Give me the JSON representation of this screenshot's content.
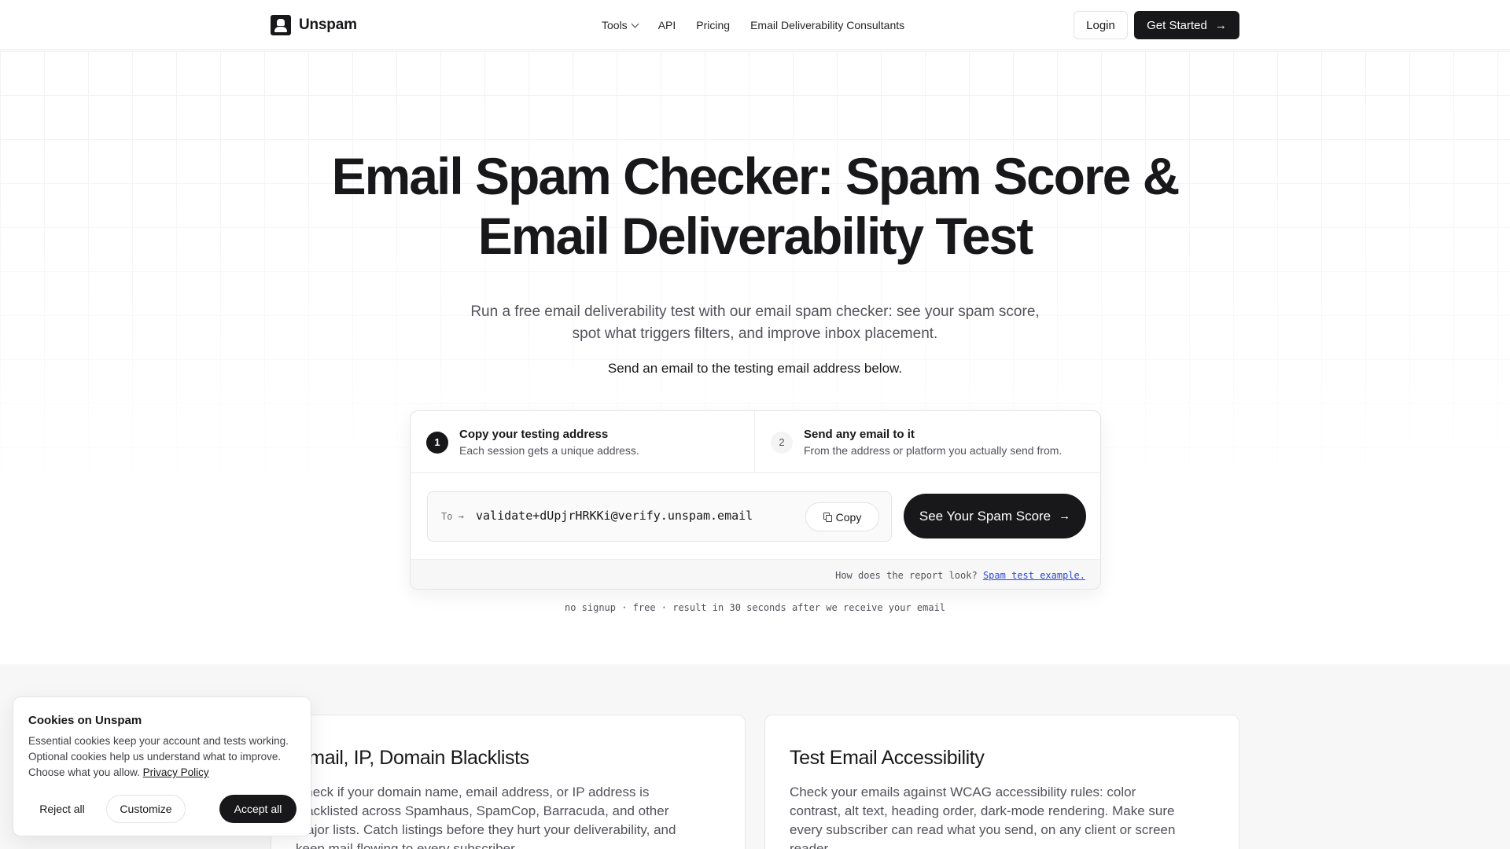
{
  "header": {
    "brand": "Unspam",
    "nav": [
      {
        "label": "Tools"
      },
      {
        "label": "API"
      },
      {
        "label": "Pricing"
      },
      {
        "label": "Email Deliverability Consultants"
      }
    ],
    "login_label": "Login",
    "get_started_label": "Get Started"
  },
  "hero": {
    "title_line1": "Email Spam Checker: Spam Score &",
    "title_line2": "Email Deliverability Test",
    "subtitle_line1": "Run a free email deliverability test with our email spam checker: see your spam score,",
    "subtitle_line2": "spot what triggers filters, and improve inbox placement.",
    "instruction": "Send an email to the testing email address below."
  },
  "tester": {
    "steps": [
      {
        "number": "1",
        "title": "Copy your testing address",
        "desc": "Each session gets a unique address."
      },
      {
        "number": "2",
        "title": "Send any email to it",
        "desc": "From the address or platform you actually send from."
      }
    ],
    "to_label": "To →",
    "address": "validate+dUpjrHRKKi@verify.unspam.email",
    "copy_label": "Copy",
    "cta_label": "See Your Spam Score",
    "footer_question": "How does the report look?",
    "footer_link": "Spam test example.",
    "tagline": "no signup · free · result in 30 seconds after we receive your email"
  },
  "features": [
    {
      "title": "Email, IP, Domain Blacklists",
      "desc": "Check if your domain name, email address, or IP address is blacklisted across Spamhaus, SpamCop, Barracuda, and other major lists. Catch listings before they hurt your deliverability, and keep mail flowing to every subscriber."
    },
    {
      "title": "Test Email Accessibility",
      "desc": "Check your emails against WCAG accessibility rules: color contrast, alt text, heading order, dark-mode rendering. Make sure every subscriber can read what you send, on any client or screen reader."
    }
  ],
  "cookie": {
    "title": "Cookies on Unspam",
    "text": "Essential cookies keep your account and tests working. Optional cookies help us understand what to improve. Choose what you allow.",
    "link": "Privacy Policy",
    "reject_label": "Reject all",
    "customize_label": "Customize",
    "accept_label": "Accept all"
  },
  "icons": {
    "tools_chevron": "chevron-down-icon",
    "arrow": "arrow-right-icon",
    "copy": "copy-icon",
    "logo": "unspam-logo-icon"
  },
  "colors": {
    "primary": "#18181b",
    "link": "#2b4bd6",
    "muted_text": "#52525b",
    "section_bg": "#f7f7f8"
  }
}
